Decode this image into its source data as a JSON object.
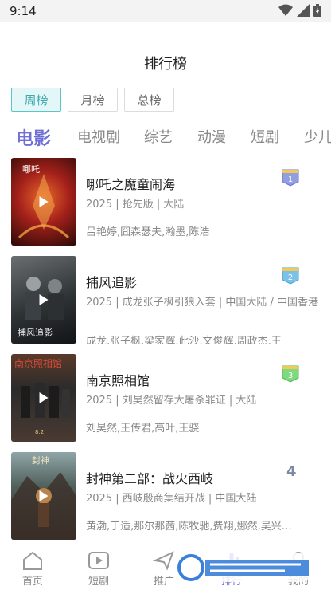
{
  "status_bar": {
    "time": "9:14"
  },
  "header": {
    "title": "排行榜"
  },
  "period_tabs": [
    {
      "label": "周榜",
      "active": true
    },
    {
      "label": "月榜",
      "active": false
    },
    {
      "label": "总榜",
      "active": false
    }
  ],
  "category_tabs": [
    {
      "label": "电影",
      "active": true
    },
    {
      "label": "电视剧",
      "active": false
    },
    {
      "label": "综艺",
      "active": false
    },
    {
      "label": "动漫",
      "active": false
    },
    {
      "label": "短剧",
      "active": false
    },
    {
      "label": "少儿",
      "active": false
    }
  ],
  "movies": [
    {
      "rank": "1",
      "title": "哪吒之魔童闹海",
      "meta": "2025 | 抢先版 | 大陆",
      "cast": "吕艳婷,囧森瑟夫,瀚墨,陈浩",
      "badge_color": "#7e8fd6"
    },
    {
      "rank": "2",
      "title": "捕风追影",
      "meta": "2025 | 成龙张子枫引狼入套 | 中国大陆 / 中国香港",
      "cast": "成龙,张子枫,梁家辉,此沙,文俊辉,周政杰,王",
      "badge_color": "#6fb6e0"
    },
    {
      "rank": "3",
      "title": "南京照相馆",
      "meta": "2025 | 刘昊然留存大屠杀罪证 | 大陆",
      "cast": "刘昊然,王传君,高叶,王骁",
      "badge_color": "#6fcf6f"
    },
    {
      "rank": "4",
      "title": "封神第二部：战火西岐",
      "meta": "2025 | 西岐殷商集结开战 | 中国大陆",
      "cast": "黄渤,于适,那尔那茜,陈牧驰,费翔,娜然,吴兴…"
    }
  ],
  "bottom_nav": [
    {
      "label": "首页",
      "icon": "home-icon",
      "active": false
    },
    {
      "label": "短剧",
      "icon": "play-square-icon",
      "active": false
    },
    {
      "label": "推广",
      "icon": "send-icon",
      "active": false
    },
    {
      "label": "排行",
      "icon": "rank-icon",
      "active": true
    },
    {
      "label": "我的",
      "icon": "user-icon",
      "active": false
    }
  ],
  "colors": {
    "accent": "#6f6fd6",
    "teal": "#5cc5c8"
  }
}
